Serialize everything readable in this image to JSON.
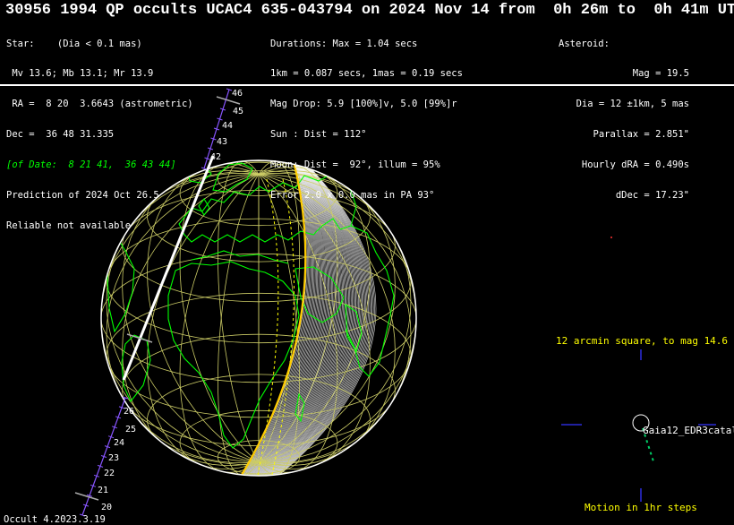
{
  "header": {
    "title": "30956 1994 QP occults UCAC4 635-043794 on 2024 Nov 14 from  0h 26m to  0h 41m UT"
  },
  "star": {
    "lines": [
      "Star:    (Dia < 0.1 mas)",
      " Mv 13.6; Mb 13.1; Mr 13.9",
      " RA =  8 20  3.6643 (astrometric)",
      "Dec =  36 48 31.335"
    ],
    "of_date": "[of Date:  8 21 41,  36 43 44]",
    "prediction": "Prediction of 2024 Oct 26.5",
    "reliability": "Reliable not available"
  },
  "event": {
    "lines": [
      "Durations: Max = 1.04 secs",
      "1km = 0.087 secs, 1mas = 0.19 secs",
      "Mag Drop: 5.9 [100%]v, 5.0 [99%]r",
      "Sun : Dist = 112°",
      "Moon: Dist =  92°, illum = 95%",
      "Error 2.0 x 0.0 mas in PA 93°"
    ]
  },
  "asteroid": {
    "header": "Asteroid:",
    "lines": [
      "Mag = 19.5",
      "Dia = 12 ±1km, 5 mas",
      "Parallax = 2.851\"",
      "Hourly dRA = 0.490s",
      "dDec = 17.23\""
    ]
  },
  "map": {
    "track_labels_top": [
      "46",
      "45",
      "44",
      "43",
      "42"
    ],
    "track_labels_bottom": [
      "26",
      "25",
      "24",
      "23",
      "22",
      "21",
      "20"
    ],
    "colors": {
      "coastline": "#00ff00",
      "graticule": "#cccc66",
      "path": "#ffffff",
      "shadow_edge": "#ffcc00",
      "night_lines": "#ffffff"
    }
  },
  "finder": {
    "caption": "12 arcmin square, to mag 14.6",
    "star_label": "Gaia12_EDR3catal",
    "motion_caption": "Motion in 1hr steps"
  },
  "footer": {
    "version": "Occult 4.2023.3.19"
  }
}
